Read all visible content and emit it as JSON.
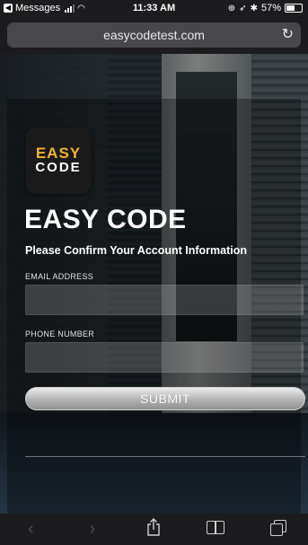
{
  "status_bar": {
    "back_app": "Messages",
    "time": "11:33 AM",
    "battery": "57%",
    "icons": [
      "signal-icon",
      "wifi-icon",
      "alarm-icon",
      "location-icon",
      "bluetooth-icon",
      "battery-icon"
    ],
    "battery_level": 0.57
  },
  "browser": {
    "url": "easycodetest.com",
    "reload_icon": "reload-icon"
  },
  "logo": {
    "top": "EASY",
    "bottom": "CODE"
  },
  "page": {
    "title": "EASY CODE",
    "subtitle": "Please Confirm Your Account Information",
    "email_label": "EMAIL ADDRESS",
    "email_value": "",
    "phone_label": "PHONE NUMBER",
    "phone_value": "",
    "submit_label": "SUBMIT"
  },
  "toolbar": {
    "back_glyph": "‹",
    "forward_glyph": "›",
    "icons": [
      "back-icon",
      "forward-icon",
      "share-icon",
      "bookmarks-icon",
      "tabs-icon"
    ]
  },
  "colors": {
    "logo_accent": "#f2b233",
    "chrome": "#1c1c1e"
  }
}
